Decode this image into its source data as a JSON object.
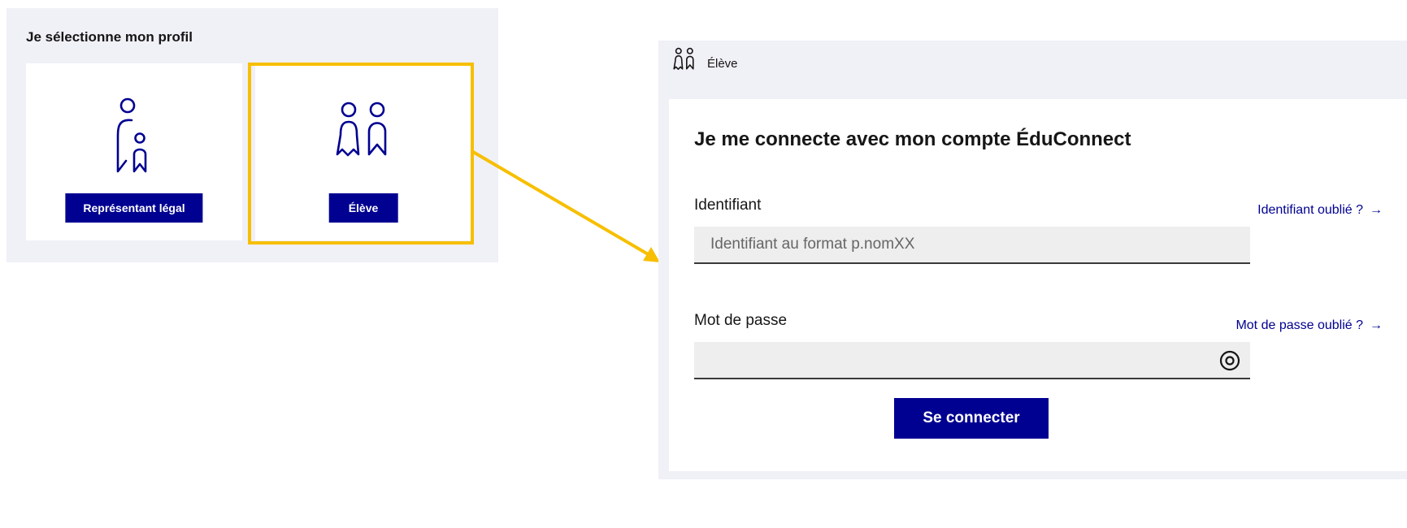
{
  "profile_selection": {
    "title": "Je sélectionne mon profil",
    "cards": [
      {
        "label": "Représentant légal",
        "icon": "parent-child-icon"
      },
      {
        "label": "Élève",
        "icon": "students-icon"
      }
    ],
    "highlight_color": "#f7bf00"
  },
  "login": {
    "header_label": "Élève",
    "header_icon": "students-icon",
    "title": "Je me connecte avec mon compte ÉduConnect",
    "identifier": {
      "label": "Identifiant",
      "forgot_link": "Identifiant oublié ?",
      "placeholder": "Identifiant au format p.nomXX",
      "value": ""
    },
    "password": {
      "label": "Mot de passe",
      "forgot_link": "Mot de passe oublié ?",
      "value": "",
      "toggle_icon": "eye-icon"
    },
    "submit_label": "Se connecter"
  },
  "colors": {
    "primary": "#000091",
    "panel_bg": "#f0f0f7",
    "highlight": "#f7bf00"
  }
}
